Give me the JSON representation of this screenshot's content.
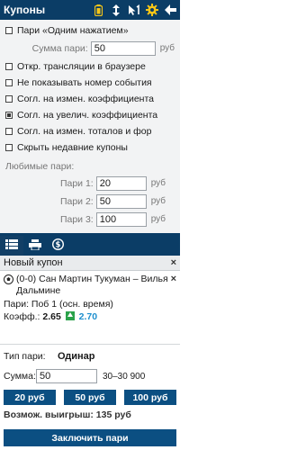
{
  "header": {
    "title": "Купоны",
    "icons": [
      "battery-icon",
      "sort-icon",
      "cursor-one-icon",
      "gear-icon",
      "back-arrow-icon"
    ],
    "accent": "#f5c518"
  },
  "options": {
    "one_click": "Пари «Одним нажатием»",
    "stake_label": "Сумма пари:",
    "stake_value": "50",
    "currency": "руб",
    "open_browser": "Откр. трансляции в браузере",
    "hide_event_no": "Не показывать номер события",
    "agree_any": "Согл. на измен. коэффициента",
    "agree_up": "Согл. на увелич. коэффициента",
    "agree_totals": "Согл. на измен. тоталов и фор",
    "hide_recent": "Скрыть недавние купоны"
  },
  "favorites": {
    "title": "Любимые пари:",
    "items": [
      {
        "label": "Пари 1:",
        "value": "20"
      },
      {
        "label": "Пари 2:",
        "value": "50"
      },
      {
        "label": "Пари 3:",
        "value": "100"
      }
    ],
    "currency": "руб"
  },
  "tabs": [
    "list-icon",
    "printer-icon",
    "money-icon"
  ],
  "coupon": {
    "title": "Новый купон",
    "close": "×",
    "event_name": "(0-0) Сан Мартин Тукуман – Вилья Дальмине",
    "bet_line": "Пари: Поб 1 (осн. время)",
    "odds_label": "Коэфф.:",
    "odds_old": "2.65",
    "odds_new": "2.70",
    "bet_type_label": "Тип пари:",
    "bet_type_value": "Одинар",
    "stake_label": "Сумма:",
    "stake_value": "50",
    "range": "30–30 900",
    "quick": [
      "20 руб",
      "50 руб",
      "100 руб"
    ],
    "win": "Возмож. выигрыш: 135 руб",
    "submit": "Заключить пари"
  }
}
